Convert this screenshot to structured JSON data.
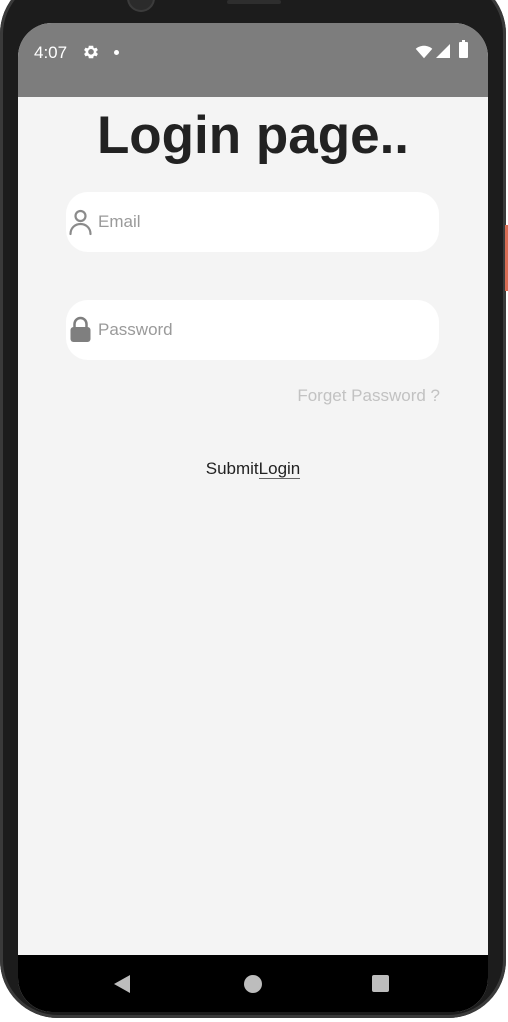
{
  "status_bar": {
    "time": "4:07",
    "icons": [
      "settings-icon",
      "notification-dot-icon",
      "wifi-icon",
      "signal-icon",
      "battery-icon"
    ],
    "background": "#7d7d7d"
  },
  "page": {
    "title": "Login page..",
    "email_placeholder": "Email",
    "password_placeholder": "Password",
    "email_icon": "user-icon",
    "password_icon": "lock-icon",
    "forgot_password": "Forget Password ?",
    "submit_text": "Submit",
    "login_text": "Login"
  },
  "nav_bar": {
    "icons": [
      "back-icon",
      "home-icon",
      "recents-icon"
    ]
  },
  "colors": {
    "screen_background": "#f4f4f4",
    "input_background": "#ffffff",
    "title_text": "#222222",
    "forgot_text": "#c2c2c2"
  }
}
